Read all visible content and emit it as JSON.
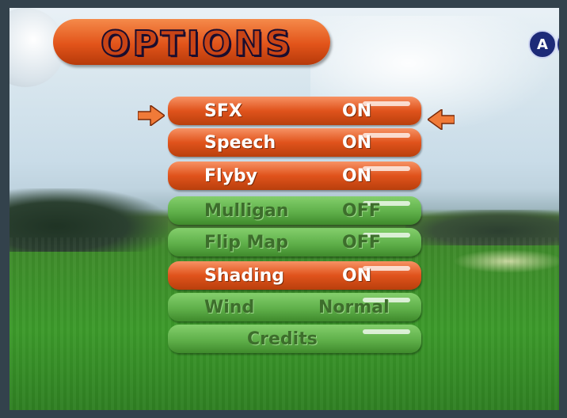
{
  "title": "OPTIONS",
  "controller_buttons": {
    "a_label": "A"
  },
  "menu": {
    "items": [
      {
        "label": "SFX",
        "value": "ON",
        "state": "on"
      },
      {
        "label": "Speech",
        "value": "ON",
        "state": "on"
      },
      {
        "label": "Flyby",
        "value": "ON",
        "state": "on"
      },
      {
        "label": "Mulligan",
        "value": "OFF",
        "state": "off"
      },
      {
        "label": "Flip Map",
        "value": "OFF",
        "state": "off"
      },
      {
        "label": "Shading",
        "value": "ON",
        "state": "on"
      },
      {
        "label": "Wind",
        "value": "Normal",
        "state": "off"
      },
      {
        "label": "Credits",
        "value": "",
        "state": "off"
      }
    ],
    "selected_index": 0
  },
  "colors": {
    "on_accent": "#e0531c",
    "off_accent": "#5fb04a",
    "selector_arrow": "#f07a38"
  },
  "icons": {
    "selector_left": "arrow-right-icon",
    "selector_right": "arrow-left-icon"
  }
}
